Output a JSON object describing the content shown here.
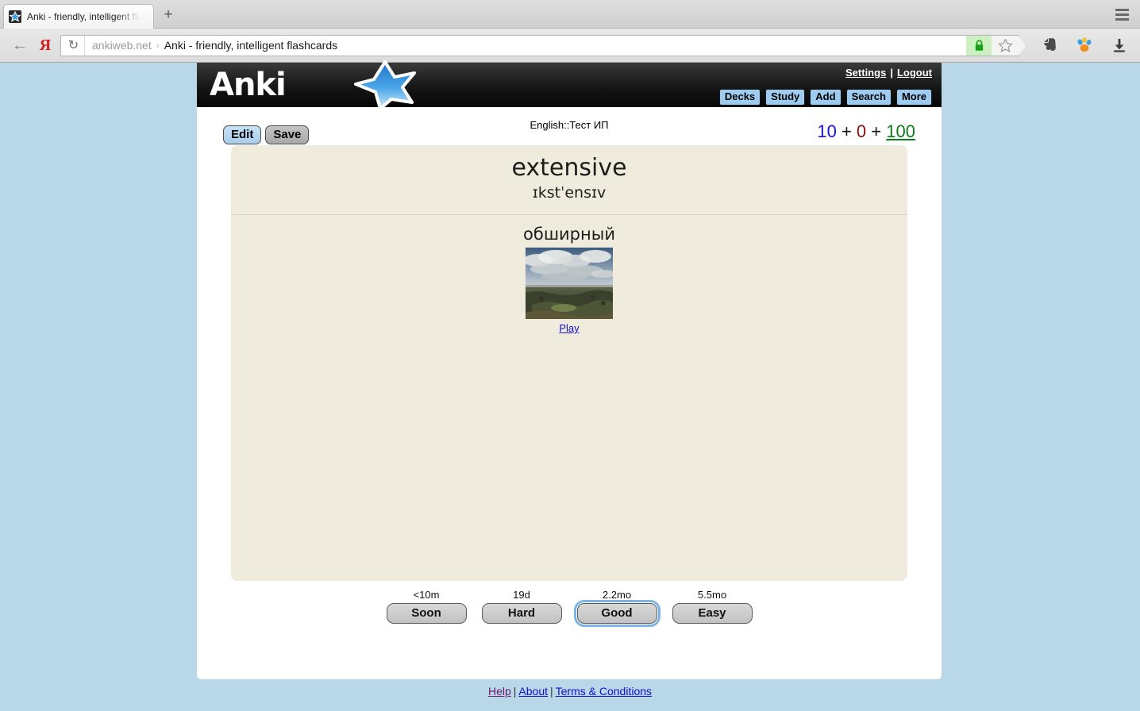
{
  "browser": {
    "tab": {
      "title": "Anki - friendly, intelligent fla",
      "favicon": "anki-star-favicon"
    },
    "new_tab_label": "+",
    "window_menu": "hamburger-menu-icon",
    "back_label": "←",
    "yandex_label": "Я",
    "reload_label": "↻",
    "omnibox": {
      "domain": "ankiweb.net",
      "separator": "›",
      "title": "Anki - friendly, intelligent flashcards",
      "lock": "secure-lock-icon",
      "bookmark": "star-outline-icon"
    },
    "extensions": [
      "evernote-icon",
      "paw-colored-icon",
      "download-arrow-icon"
    ]
  },
  "site": {
    "logo_text": "Anki",
    "logo_icon": "blue-star-logo",
    "header_links": {
      "settings": "Settings",
      "separator": "|",
      "logout": "Logout"
    },
    "nav": [
      "Decks",
      "Study",
      "Add",
      "Search",
      "More"
    ]
  },
  "study": {
    "deck_name": "English::Тест ИП",
    "edit_label": "Edit",
    "save_label": "Save",
    "counters": {
      "new": "10",
      "plus1": "+",
      "learning": "0",
      "plus2": "+",
      "review": "100",
      "color_new": "#1510f0",
      "color_learning": "#8b0e0e",
      "color_review": "#0a7c18"
    },
    "card": {
      "word": "extensive",
      "ipa": "ɪkstˈensɪv",
      "answer": "обширный",
      "image_alt": "panoramic-landscape-painting",
      "play_label": "Play"
    },
    "answer_buttons": [
      {
        "time": "<10m",
        "label": "Soon",
        "focused": false
      },
      {
        "time": "19d",
        "label": "Hard",
        "focused": false
      },
      {
        "time": "2.2mo",
        "label": "Good",
        "focused": true
      },
      {
        "time": "5.5mo",
        "label": "Easy",
        "focused": false
      }
    ]
  },
  "footer": {
    "help": "Help",
    "sep1": "|",
    "about": "About",
    "sep2": "|",
    "terms": "Terms & Conditions"
  }
}
